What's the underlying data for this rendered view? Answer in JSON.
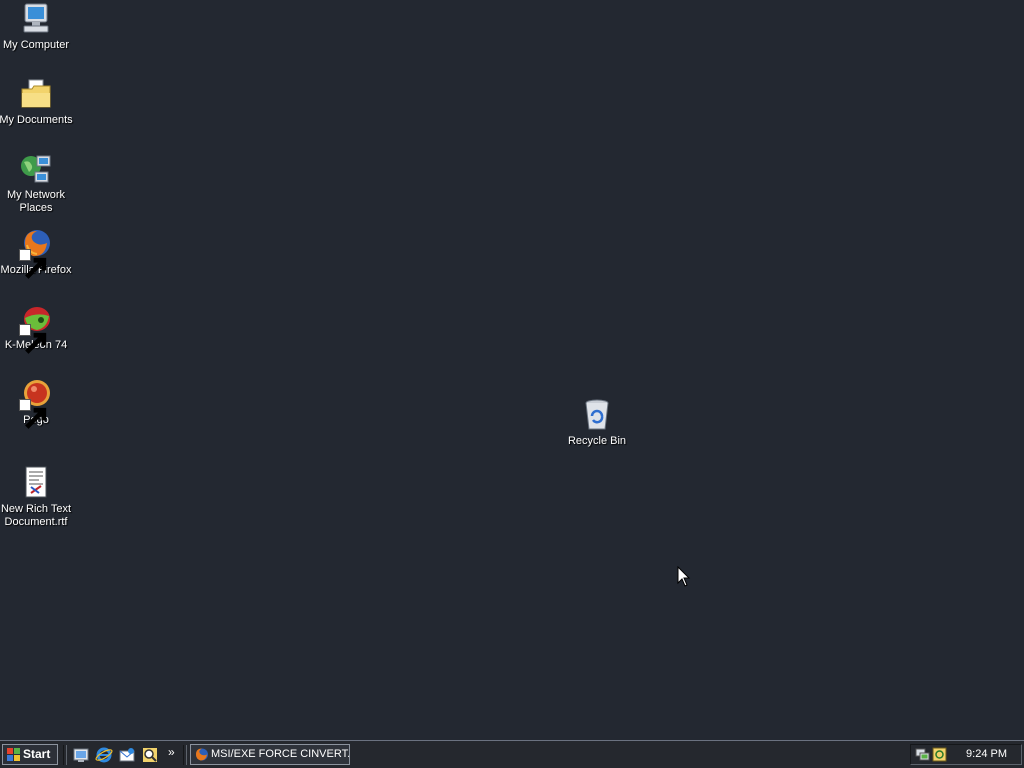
{
  "desktop": {
    "icons": [
      {
        "label": "My Computer",
        "icon": "computer-icon"
      },
      {
        "label": "My Documents",
        "icon": "documents-folder-icon"
      },
      {
        "label": "My Network Places",
        "icon": "network-places-icon"
      },
      {
        "label": "Mozilla Firefox",
        "icon": "firefox-icon"
      },
      {
        "label": "K-Meleon 74",
        "icon": "kmeleon-icon"
      },
      {
        "label": "Pego",
        "icon": "pego-icon"
      },
      {
        "label": "New Rich Text Document.rtf",
        "icon": "rtf-document-icon"
      },
      {
        "label": "Recycle Bin",
        "icon": "recycle-bin-icon"
      }
    ]
  },
  "taskbar": {
    "start_label": "Start",
    "quick_launch": [
      "show-desktop-icon",
      "internet-explorer-icon",
      "outlook-express-icon",
      "search-icon"
    ],
    "more_label": "»",
    "tasks": [
      {
        "label": "MSI/EXE FORCE CINVERT...",
        "icon": "firefox-icon"
      }
    ],
    "tray_icons": [
      "network-tray-icon",
      "update-tray-icon"
    ],
    "clock": "9:24 PM"
  },
  "colors": {
    "desktop_background": "#232831",
    "taskbar_background": "#25282e"
  }
}
